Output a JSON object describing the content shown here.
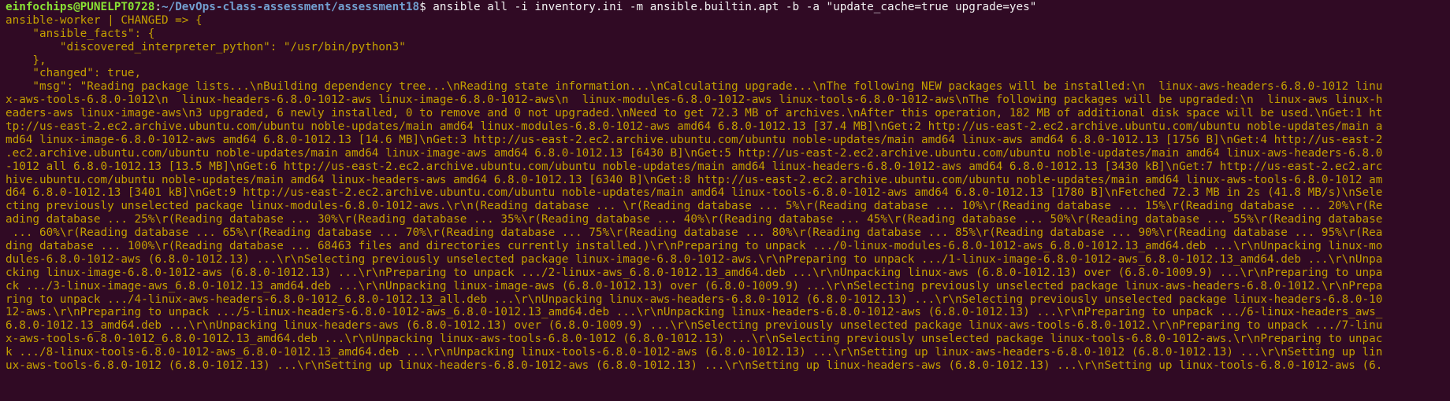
{
  "colors": {
    "background": "#300a24",
    "text": "#f2f2f2",
    "prompt_user": "#8ae234",
    "prompt_path": "#729fcf",
    "changed_output": "#c4a000"
  },
  "prompt": {
    "user_host": "einfochips@PUNELPT0728",
    "separator": ":",
    "path": "~/DevOps-class-assessment/assessment18",
    "dollar": "$ ",
    "command": "ansible all -i inventory.ini -m ansible.builtin.apt -b -a \"update_cache=true upgrade=yes\""
  },
  "output_lines": [
    "ansible-worker | CHANGED => {",
    "    \"ansible_facts\": {",
    "        \"discovered_interpreter_python\": \"/usr/bin/python3\"",
    "    },",
    "    \"changed\": true,",
    "    \"msg\": \"Reading package lists...\\nBuilding dependency tree...\\nReading state information...\\nCalculating upgrade...\\nThe following NEW packages will be installed:\\n  linux-aws-headers-6.8.0-1012 linu",
    "x-aws-tools-6.8.0-1012\\n  linux-headers-6.8.0-1012-aws linux-image-6.8.0-1012-aws\\n  linux-modules-6.8.0-1012-aws linux-tools-6.8.0-1012-aws\\nThe following packages will be upgraded:\\n  linux-aws linux-h",
    "eaders-aws linux-image-aws\\n3 upgraded, 6 newly installed, 0 to remove and 0 not upgraded.\\nNeed to get 72.3 MB of archives.\\nAfter this operation, 182 MB of additional disk space will be used.\\nGet:1 ht",
    "tp://us-east-2.ec2.archive.ubuntu.com/ubuntu noble-updates/main amd64 linux-modules-6.8.0-1012-aws amd64 6.8.0-1012.13 [37.4 MB]\\nGet:2 http://us-east-2.ec2.archive.ubuntu.com/ubuntu noble-updates/main a",
    "md64 linux-image-6.8.0-1012-aws amd64 6.8.0-1012.13 [14.6 MB]\\nGet:3 http://us-east-2.ec2.archive.ubuntu.com/ubuntu noble-updates/main amd64 linux-aws amd64 6.8.0-1012.13 [1756 B]\\nGet:4 http://us-east-2",
    ".ec2.archive.ubuntu.com/ubuntu noble-updates/main amd64 linux-image-aws amd64 6.8.0-1012.13 [6430 B]\\nGet:5 http://us-east-2.ec2.archive.ubuntu.com/ubuntu noble-updates/main amd64 linux-aws-headers-6.8.0",
    "-1012 all 6.8.0-1012.13 [13.5 MB]\\nGet:6 http://us-east-2.ec2.archive.ubuntu.com/ubuntu noble-updates/main amd64 linux-headers-6.8.0-1012-aws amd64 6.8.0-1012.13 [3430 kB]\\nGet:7 http://us-east-2.ec2.arc",
    "hive.ubuntu.com/ubuntu noble-updates/main amd64 linux-headers-aws amd64 6.8.0-1012.13 [6340 B]\\nGet:8 http://us-east-2.ec2.archive.ubuntu.com/ubuntu noble-updates/main amd64 linux-aws-tools-6.8.0-1012 am",
    "d64 6.8.0-1012.13 [3401 kB]\\nGet:9 http://us-east-2.ec2.archive.ubuntu.com/ubuntu noble-updates/main amd64 linux-tools-6.8.0-1012-aws amd64 6.8.0-1012.13 [1780 B]\\nFetched 72.3 MB in 2s (41.8 MB/s)\\nSele",
    "cting previously unselected package linux-modules-6.8.0-1012-aws.\\r\\n(Reading database ... \\r(Reading database ... 5%\\r(Reading database ... 10%\\r(Reading database ... 15%\\r(Reading database ... 20%\\r(Re",
    "ading database ... 25%\\r(Reading database ... 30%\\r(Reading database ... 35%\\r(Reading database ... 40%\\r(Reading database ... 45%\\r(Reading database ... 50%\\r(Reading database ... 55%\\r(Reading database",
    " ... 60%\\r(Reading database ... 65%\\r(Reading database ... 70%\\r(Reading database ... 75%\\r(Reading database ... 80%\\r(Reading database ... 85%\\r(Reading database ... 90%\\r(Reading database ... 95%\\r(Rea",
    "ding database ... 100%\\r(Reading database ... 68463 files and directories currently installed.)\\r\\nPreparing to unpack .../0-linux-modules-6.8.0-1012-aws_6.8.0-1012.13_amd64.deb ...\\r\\nUnpacking linux-mo",
    "dules-6.8.0-1012-aws (6.8.0-1012.13) ...\\r\\nSelecting previously unselected package linux-image-6.8.0-1012-aws.\\r\\nPreparing to unpack .../1-linux-image-6.8.0-1012-aws_6.8.0-1012.13_amd64.deb ...\\r\\nUnpa",
    "cking linux-image-6.8.0-1012-aws (6.8.0-1012.13) ...\\r\\nPreparing to unpack .../2-linux-aws_6.8.0-1012.13_amd64.deb ...\\r\\nUnpacking linux-aws (6.8.0-1012.13) over (6.8.0-1009.9) ...\\r\\nPreparing to unpa",
    "ck .../3-linux-image-aws_6.8.0-1012.13_amd64.deb ...\\r\\nUnpacking linux-image-aws (6.8.0-1012.13) over (6.8.0-1009.9) ...\\r\\nSelecting previously unselected package linux-aws-headers-6.8.0-1012.\\r\\nPrepa",
    "ring to unpack .../4-linux-aws-headers-6.8.0-1012_6.8.0-1012.13_all.deb ...\\r\\nUnpacking linux-aws-headers-6.8.0-1012 (6.8.0-1012.13) ...\\r\\nSelecting previously unselected package linux-headers-6.8.0-10",
    "12-aws.\\r\\nPreparing to unpack .../5-linux-headers-6.8.0-1012-aws_6.8.0-1012.13_amd64.deb ...\\r\\nUnpacking linux-headers-6.8.0-1012-aws (6.8.0-1012.13) ...\\r\\nPreparing to unpack .../6-linux-headers_aws_",
    "6.8.0-1012.13_amd64.deb ...\\r\\nUnpacking linux-headers-aws (6.8.0-1012.13) over (6.8.0-1009.9) ...\\r\\nSelecting previously unselected package linux-aws-tools-6.8.0-1012.\\r\\nPreparing to unpack .../7-linu",
    "x-aws-tools-6.8.0-1012_6.8.0-1012.13_amd64.deb ...\\r\\nUnpacking linux-aws-tools-6.8.0-1012 (6.8.0-1012.13) ...\\r\\nSelecting previously unselected package linux-tools-6.8.0-1012-aws.\\r\\nPreparing to unpac",
    "k .../8-linux-tools-6.8.0-1012-aws_6.8.0-1012.13_amd64.deb ...\\r\\nUnpacking linux-tools-6.8.0-1012-aws (6.8.0-1012.13) ...\\r\\nSetting up linux-aws-headers-6.8.0-1012 (6.8.0-1012.13) ...\\r\\nSetting up lin",
    "ux-aws-tools-6.8.0-1012 (6.8.0-1012.13) ...\\r\\nSetting up linux-headers-6.8.0-1012-aws (6.8.0-1012.13) ...\\r\\nSetting up linux-headers-aws (6.8.0-1012.13) ...\\r\\nSetting up linux-tools-6.8.0-1012-aws (6."
  ]
}
